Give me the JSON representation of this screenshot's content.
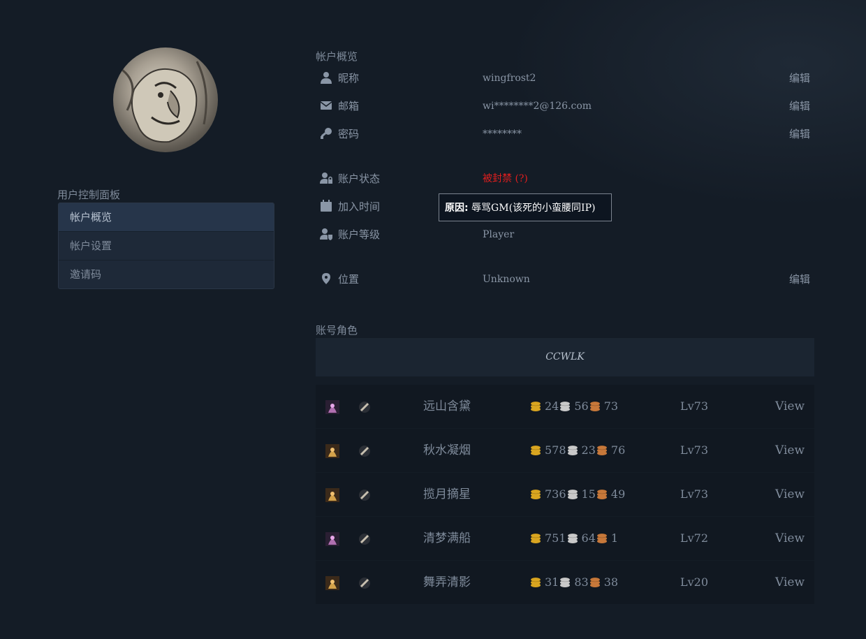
{
  "sidebar": {
    "panel_title": "用户控制面板",
    "items": [
      {
        "label": "帐户概览",
        "active": true
      },
      {
        "label": "帐户设置",
        "active": false
      },
      {
        "label": "邀请码",
        "active": false
      }
    ]
  },
  "overview": {
    "title": "帐户概览",
    "edit_label": "编辑",
    "nickname": {
      "label": "昵称",
      "value": "wingfrost2",
      "icon": "user-icon"
    },
    "email": {
      "label": "邮箱",
      "value": "wi********2@126.com",
      "icon": "envelope-icon"
    },
    "password": {
      "label": "密码",
      "value": "********",
      "icon": "key-icon"
    },
    "status": {
      "label": "账户状态",
      "value": "被封禁 (?)",
      "icon": "user-lock-icon",
      "color": "#e01e1e"
    },
    "join_time": {
      "label": "加入时间",
      "icon": "calendar-icon"
    },
    "level": {
      "label": "账户等级",
      "value": "Player",
      "icon": "user-shield-icon"
    },
    "location": {
      "label": "位置",
      "value": "Unknown",
      "icon": "map-pin-icon"
    }
  },
  "tooltip": {
    "prefix": "原因:",
    "text": "辱骂GM(该死的小蛮腰同IP)"
  },
  "characters": {
    "title": "账号角色",
    "realm": "CCWLK",
    "view_label": "View",
    "rows": [
      {
        "name": "远山含黛",
        "gold": "24",
        "silver": "56",
        "copper": "73",
        "level": "Lv73"
      },
      {
        "name": "秋水凝烟",
        "gold": "578",
        "silver": "23",
        "copper": "76",
        "level": "Lv73"
      },
      {
        "name": "揽月摘星",
        "gold": "736",
        "silver": "15",
        "copper": "49",
        "level": "Lv73"
      },
      {
        "name": "清梦满船",
        "gold": "751",
        "silver": "64",
        "copper": "1",
        "level": "Lv72"
      },
      {
        "name": "舞弄清影",
        "gold": "31",
        "silver": "83",
        "copper": "38",
        "level": "Lv20"
      }
    ]
  },
  "colors": {
    "gold": "#d9a520",
    "silver": "#c9c9c9",
    "copper": "#c7783a"
  }
}
